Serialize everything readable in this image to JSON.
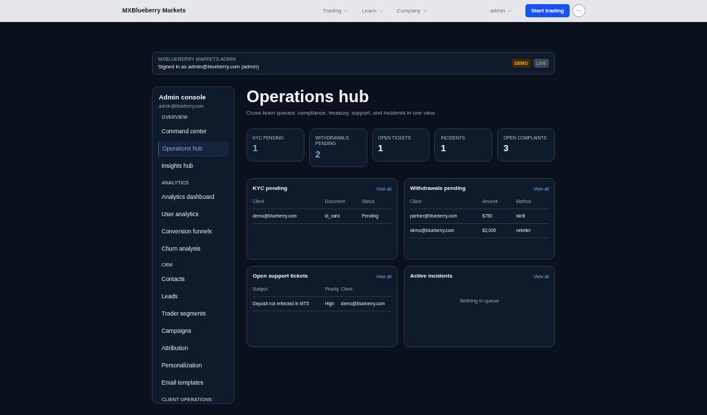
{
  "topnav": {
    "brand": "MXBlueberry Markets",
    "menus": [
      {
        "label": "Trading"
      },
      {
        "label": "Learn"
      },
      {
        "label": "Company"
      }
    ],
    "user": "admin",
    "cta": "Start trading",
    "more": "···"
  },
  "banner": {
    "eyebrow": "MXBLUEBERRY MARKETS ADMIN",
    "text": "Signed in as admin@blueberry.com (admin)",
    "modes": [
      {
        "label": "DEMO",
        "selected": true
      },
      {
        "label": "LIVE",
        "selected": false
      }
    ]
  },
  "sidebar": {
    "title": "Admin console",
    "email": "admin@blueberry.com",
    "sections": [
      {
        "heading": "OVERVIEW",
        "items": [
          {
            "label": "Command center",
            "selected": false
          },
          {
            "label": "Operations hub",
            "selected": true
          },
          {
            "label": "Insights hub",
            "selected": false
          }
        ]
      },
      {
        "heading": "ANALYTICS",
        "items": [
          {
            "label": "Analytics dashboard",
            "selected": false
          },
          {
            "label": "User analytics",
            "selected": false
          },
          {
            "label": "Conversion funnels",
            "selected": false
          },
          {
            "label": "Churn analysis",
            "selected": false
          }
        ]
      },
      {
        "heading": "CRM",
        "items": [
          {
            "label": "Contacts",
            "selected": false
          },
          {
            "label": "Leads",
            "selected": false
          },
          {
            "label": "Trader segments",
            "selected": false
          },
          {
            "label": "Campaigns",
            "selected": false
          },
          {
            "label": "Attribution",
            "selected": false
          },
          {
            "label": "Personalization",
            "selected": false
          },
          {
            "label": "Email templates",
            "selected": false
          }
        ]
      },
      {
        "heading": "CLIENT OPERATIONS"
      }
    ]
  },
  "page": {
    "title": "Operations hub",
    "subtitle": "Cross-team queues: compliance, treasury, support, and incidents in one view."
  },
  "metrics": [
    {
      "label": "KYC PENDING",
      "value": "1",
      "accent": true
    },
    {
      "label": "WITHDRAWALS PENDING",
      "value": "2",
      "accent": true
    },
    {
      "label": "OPEN TICKETS",
      "value": "1",
      "accent": false
    },
    {
      "label": "INCIDENTS",
      "value": "1",
      "accent": false
    },
    {
      "label": "OPEN COMPLAINTS",
      "value": "3",
      "accent": false
    }
  ],
  "panels": [
    {
      "title": "KYC pending",
      "link": "View all",
      "columns": [
        "Client",
        "Document",
        "Status"
      ],
      "rows": [
        [
          "demo@blueberry.com",
          "id_card",
          "Pending"
        ]
      ]
    },
    {
      "title": "Withdrawals pending",
      "link": "View all",
      "columns": [
        "Client",
        "Amount",
        "Method"
      ],
      "rows": [
        [
          "partner@blueberry.com",
          "$750",
          "skrill"
        ],
        [
          "demo@blueberry.com",
          "$2,000",
          "neteller"
        ]
      ]
    },
    {
      "title": "Open support tickets",
      "link": "View all",
      "columns": [
        "Subject",
        "Priority",
        "Client"
      ],
      "rows": [
        [
          "Deposit not reflected in MT5",
          "High",
          "demo@blueberry.com"
        ]
      ]
    },
    {
      "title": "Active incidents",
      "link": "View all",
      "empty": "Nothing in queue"
    }
  ]
}
